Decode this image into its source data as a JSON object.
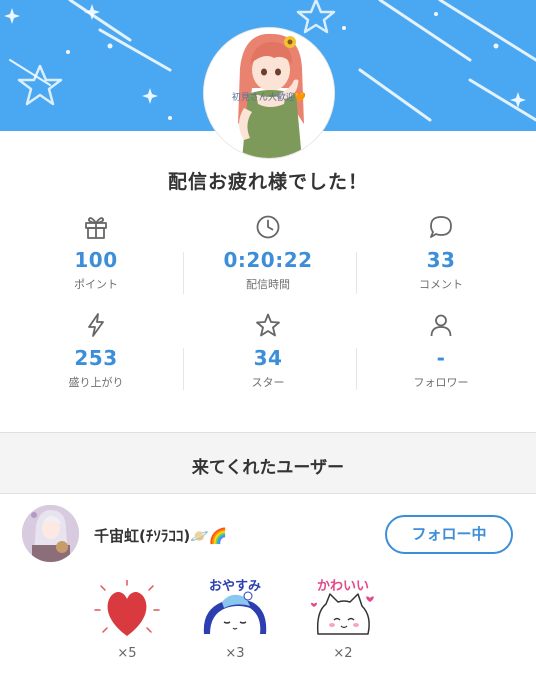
{
  "header": {
    "avatar_caption": "初見さん大歓迎🧡"
  },
  "title": "配信お疲れ様でした！",
  "stats": [
    {
      "icon": "gift-icon",
      "value": "100",
      "label": "ポイント"
    },
    {
      "icon": "clock-icon",
      "value": "0:20:22",
      "label": "配信時間"
    },
    {
      "icon": "comment-icon",
      "value": "33",
      "label": "コメント"
    },
    {
      "icon": "lightning-icon",
      "value": "253",
      "label": "盛り上がり"
    },
    {
      "icon": "star-icon",
      "value": "34",
      "label": "スター"
    },
    {
      "icon": "person-icon",
      "value": "-",
      "label": "フォロワー"
    }
  ],
  "visitors_section": {
    "title": "来てくれたユーザー"
  },
  "user": {
    "name": "千宙虹(ﾁｿﾗｺｺ)🪐🌈",
    "follow_label": "フォロー中"
  },
  "gifts": [
    {
      "icon": "heart-icon",
      "count": "×5"
    },
    {
      "icon": "oyasumi-sticker-icon",
      "count": "×3",
      "text": "おやすみ"
    },
    {
      "icon": "kawaii-sticker-icon",
      "count": "×2",
      "text": "かわいい"
    }
  ],
  "colors": {
    "banner": "#4aa8f2",
    "accent": "#3d8ed9"
  }
}
